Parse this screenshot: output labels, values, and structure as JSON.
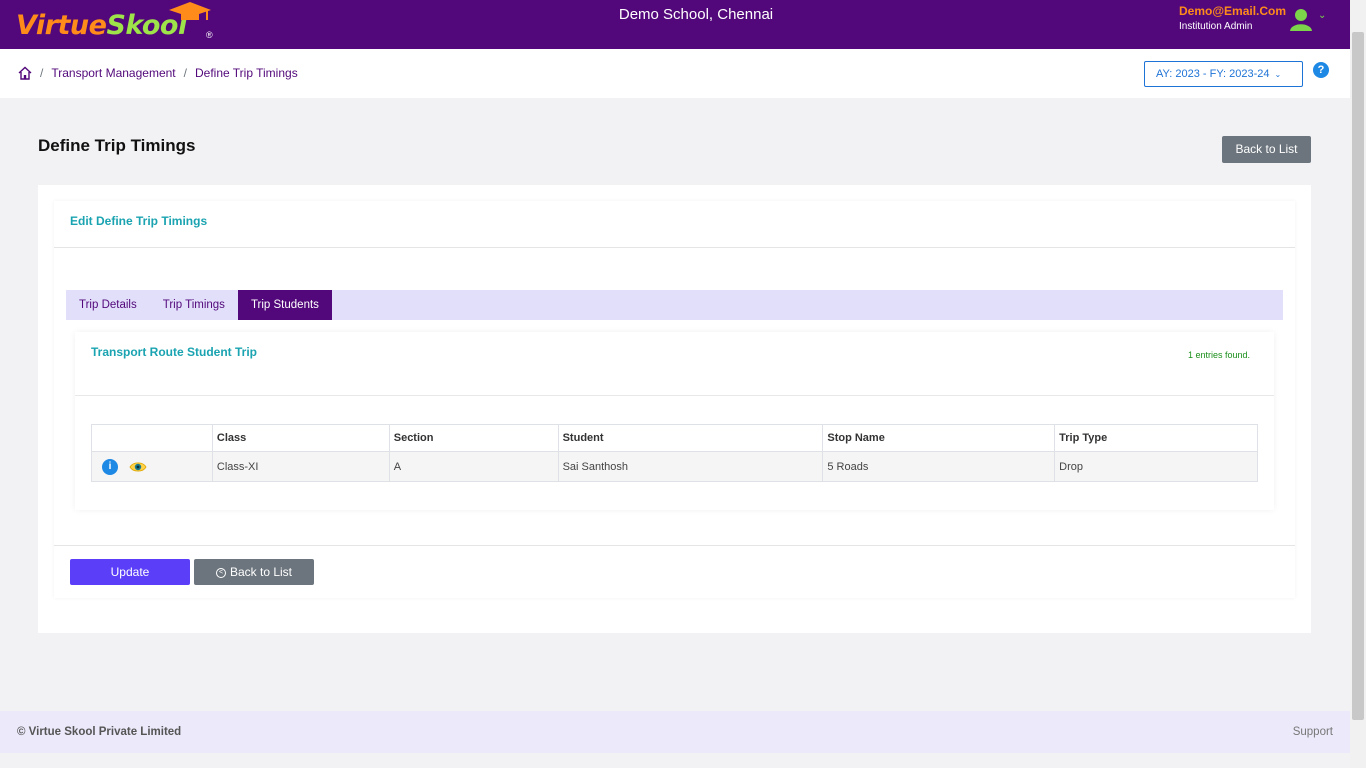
{
  "header": {
    "logo_text_a": "Virtue",
    "logo_text_b": "Skool",
    "logo_reg": "®",
    "school_name": "Demo School, Chennai",
    "user_email": "Demo@Email.Com",
    "user_role": "Institution Admin",
    "caret": "⌄"
  },
  "breadcrumb": {
    "sep1": "/",
    "item1": "Transport Management",
    "sep2": "/",
    "item2": "Define Trip Timings"
  },
  "year_selector": {
    "value": "AY: 2023 - FY: 2023-24",
    "chevron": "⌄"
  },
  "help": {
    "label": "?"
  },
  "page": {
    "title": "Define Trip Timings",
    "back_to_list": "Back to List"
  },
  "edit_card": {
    "title": "Edit Define Trip Timings",
    "tabs": [
      {
        "label": "Trip Details",
        "active": false
      },
      {
        "label": "Trip Timings",
        "active": false
      },
      {
        "label": "Trip Students",
        "active": true
      }
    ]
  },
  "student_trip": {
    "title": "Transport Route Student Trip",
    "entries_found": "1 entries found.",
    "columns": [
      "",
      "Class",
      "Section",
      "Student",
      "Stop Name",
      "Trip Type"
    ],
    "rows": [
      {
        "class": "Class-XI",
        "section": "A",
        "student": "Sai Santhosh",
        "stop_name": "5 Roads",
        "trip_type": "Drop",
        "info_icon": "i"
      }
    ]
  },
  "actions": {
    "update": "Update",
    "back_to_list": "Back to List",
    "back_glyph": "<"
  },
  "footer": {
    "copyright": "© Virtue Skool Private Limited",
    "support": "Support"
  },
  "colors": {
    "header_bg": "#52087a",
    "accent_teal": "#1aa3b0",
    "update_button": "#5b3ff8",
    "secondary_button": "#6c757d",
    "tab_strip": "#e2dffb"
  }
}
